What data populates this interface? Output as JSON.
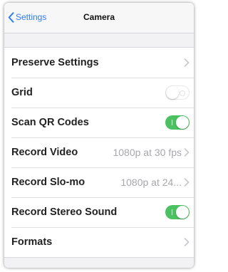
{
  "navbar": {
    "back_label": "Settings",
    "title": "Camera"
  },
  "rows": [
    {
      "label": "Preserve Settings",
      "type": "disclosure"
    },
    {
      "label": "Grid",
      "type": "toggle",
      "on": false
    },
    {
      "label": "Scan QR Codes",
      "type": "toggle",
      "on": true
    },
    {
      "label": "Record Video",
      "type": "disclosure",
      "value": "1080p at 30 fps"
    },
    {
      "label": "Record Slo-mo",
      "type": "disclosure",
      "value": "1080p at 24..."
    },
    {
      "label": "Record Stereo Sound",
      "type": "toggle",
      "on": true
    },
    {
      "label": "Formats",
      "type": "disclosure"
    }
  ],
  "colors": {
    "accent": "#2f7cf6",
    "toggle_on": "#4bc261",
    "secondary_text": "#a7a7ac"
  },
  "icons": {
    "back": "chevron-left-icon",
    "disclosure": "chevron-right-icon"
  }
}
